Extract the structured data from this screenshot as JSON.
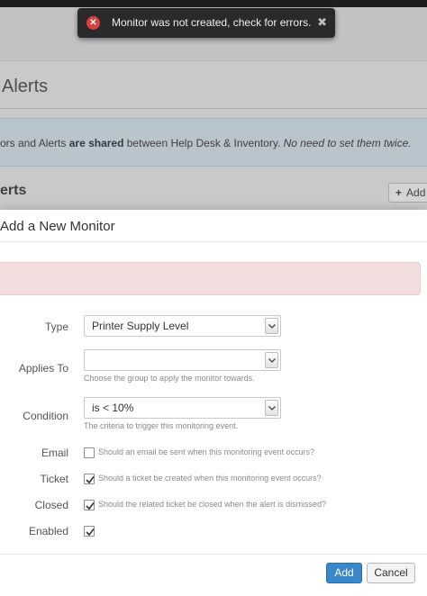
{
  "toast": {
    "message": "Monitor was not created, check for errors.",
    "close_glyph": "✖",
    "icon": "error-icon",
    "icon_glyph": "✕",
    "icon_color": "#d9413c"
  },
  "background": {
    "page_title": "Alerts",
    "info_part1": "ors and Alerts ",
    "info_bold": "are shared",
    "info_part2": " between Help Desk & Inventory. ",
    "info_italic": "No need to set them twice.",
    "section_title": "erts",
    "add_plus": "+",
    "add_label": "Add"
  },
  "modal": {
    "title": "Add a New Monitor",
    "alert_color": "#f2dede",
    "fields": {
      "type": {
        "label": "Type",
        "value": "Printer Supply Level"
      },
      "applies_to": {
        "label": "Applies To",
        "value": "",
        "hint": "Choose the group to apply the monitor towards."
      },
      "condition": {
        "label": "Condition",
        "value": "is < 10%",
        "hint": "The criteria to trigger this monitoring event."
      },
      "email": {
        "label": "Email",
        "checked": false,
        "text": "Should an email be sent when this monitoring event occurs?"
      },
      "ticket": {
        "label": "Ticket",
        "checked": true,
        "text": "Should a ticket be created when this monitoring event occurs?"
      },
      "closed": {
        "label": "Closed",
        "checked": true,
        "text": "Should the related ticket be closed when the alert is dismissed?"
      },
      "enabled": {
        "label": "Enabled",
        "checked": true
      }
    },
    "buttons": {
      "add": "Add",
      "cancel": "Cancel"
    },
    "primary_color": "#3a87c9"
  }
}
